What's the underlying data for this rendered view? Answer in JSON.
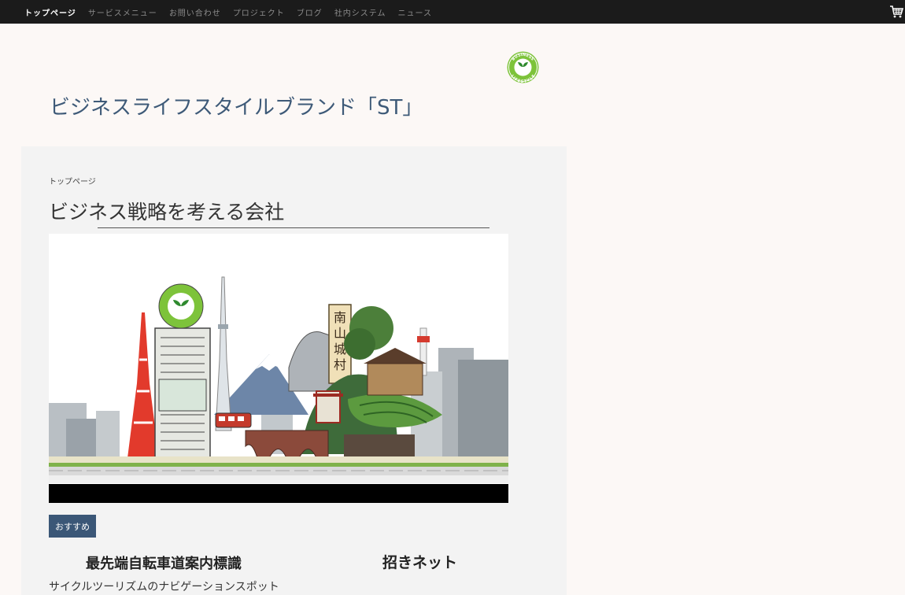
{
  "nav": {
    "items": [
      {
        "label": "トップページ"
      },
      {
        "label": "サービスメニュー"
      },
      {
        "label": "お問い合わせ"
      },
      {
        "label": "プロジェクト"
      },
      {
        "label": "ブログ"
      },
      {
        "label": "社内システム"
      },
      {
        "label": "ニュース"
      }
    ],
    "active_index": 0
  },
  "logo": {
    "text_top": "BUSINESS",
    "text_bottom": "LIFESTYLE"
  },
  "site": {
    "title": "ビジネスライフスタイルブランド「ST」"
  },
  "main": {
    "breadcrumb": "トップページ",
    "page_title": "ビジネス戦略を考える会社",
    "hero_sign": [
      "南",
      "山",
      "城",
      "村"
    ],
    "badge": "おすすめ",
    "cards": [
      {
        "title": "最先端自転車道案内標識",
        "description": "サイクルツーリズムのナビゲーションスポット"
      },
      {
        "title": "招きネット"
      }
    ]
  },
  "colors": {
    "topbar": "#1b1b1b",
    "accent": "#3b5777",
    "title": "#3e5a78",
    "logo_green": "#7dc33a"
  },
  "icons": {
    "cart": "cart-icon"
  }
}
